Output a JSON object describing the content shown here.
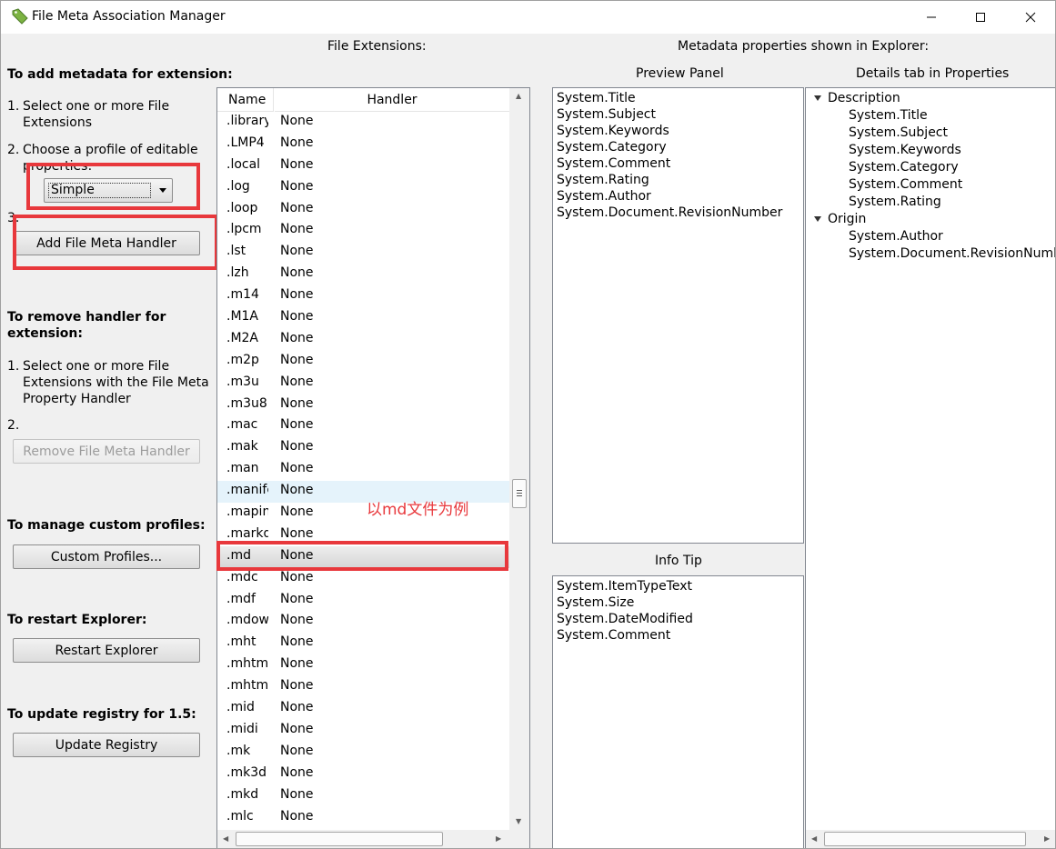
{
  "window": {
    "title": "File Meta Association Manager",
    "controls": {
      "minimize": "—",
      "maximize": "☐",
      "close": "✕"
    }
  },
  "headers": {
    "file_extensions": "File Extensions:",
    "metadata_properties": "Metadata properties shown in Explorer:",
    "preview_panel": "Preview Panel",
    "details_tab": "Details tab in Properties",
    "info_tip": "Info Tip"
  },
  "left": {
    "add_heading": "To add metadata for extension:",
    "add_step1_num": "1.",
    "add_step1_text": "Select one or more File Extensions",
    "add_step2_num": "2.",
    "add_step2_text": "Choose a profile of editable properties:",
    "profile_selected": "Simple",
    "add_step3_num": "3.",
    "add_button": "Add File Meta Handler",
    "remove_heading": "To remove handler for extension:",
    "remove_step1_num": "1.",
    "remove_step1_text": "Select one or more File Extensions with the File Meta Property Handler",
    "remove_step2_num": "2.",
    "remove_button": "Remove File Meta Handler",
    "custom_heading": "To manage custom profiles:",
    "custom_button": "Custom Profiles...",
    "restart_heading": "To restart Explorer:",
    "restart_button": "Restart Explorer",
    "update_heading": "To update registry for 1.5:",
    "update_button": "Update Registry"
  },
  "extension_list": {
    "columns": {
      "name": "Name",
      "handler": "Handler"
    },
    "rows": [
      {
        "name": ".library",
        "handler": "None"
      },
      {
        "name": ".LMP4",
        "handler": "None"
      },
      {
        "name": ".local",
        "handler": "None"
      },
      {
        "name": ".log",
        "handler": "None"
      },
      {
        "name": ".loop",
        "handler": "None"
      },
      {
        "name": ".lpcm",
        "handler": "None"
      },
      {
        "name": ".lst",
        "handler": "None"
      },
      {
        "name": ".lzh",
        "handler": "None"
      },
      {
        "name": ".m14",
        "handler": "None"
      },
      {
        "name": ".M1A",
        "handler": "None"
      },
      {
        "name": ".M2A",
        "handler": "None"
      },
      {
        "name": ".m2p",
        "handler": "None"
      },
      {
        "name": ".m3u",
        "handler": "None"
      },
      {
        "name": ".m3u8",
        "handler": "None"
      },
      {
        "name": ".mac",
        "handler": "None"
      },
      {
        "name": ".mak",
        "handler": "None"
      },
      {
        "name": ".man",
        "handler": "None"
      },
      {
        "name": ".manifest",
        "handler": "None"
      },
      {
        "name": ".mapin",
        "handler": "None"
      },
      {
        "name": ".markd",
        "handler": "None"
      },
      {
        "name": ".md",
        "handler": "None"
      },
      {
        "name": ".mdc",
        "handler": "None"
      },
      {
        "name": ".mdf",
        "handler": "None"
      },
      {
        "name": ".mdow",
        "handler": "None"
      },
      {
        "name": ".mht",
        "handler": "None"
      },
      {
        "name": ".mhtm",
        "handler": "None"
      },
      {
        "name": ".mhtml",
        "handler": "None"
      },
      {
        "name": ".mid",
        "handler": "None"
      },
      {
        "name": ".midi",
        "handler": "None"
      },
      {
        "name": ".mk",
        "handler": "None"
      },
      {
        "name": ".mk3d",
        "handler": "None"
      },
      {
        "name": ".mkd",
        "handler": "None"
      },
      {
        "name": ".mlc",
        "handler": "None"
      }
    ],
    "hover_index": 17,
    "selected_index": 20
  },
  "annotation": "以md文件为例",
  "preview_panel_items": [
    "System.Title",
    "System.Subject",
    "System.Keywords",
    "System.Category",
    "System.Comment",
    "System.Rating",
    "System.Author",
    "System.Document.RevisionNumber"
  ],
  "details_tree": {
    "groups": [
      {
        "label": "Description",
        "items": [
          "System.Title",
          "System.Subject",
          "System.Keywords",
          "System.Category",
          "System.Comment",
          "System.Rating"
        ]
      },
      {
        "label": "Origin",
        "items": [
          "System.Author",
          "System.Document.RevisionNumber"
        ]
      }
    ]
  },
  "info_tip_items": [
    "System.ItemTypeText",
    "System.Size",
    "System.DateModified",
    "System.Comment"
  ],
  "colors": {
    "highlight_red": "#e8383c",
    "hover_row": "#e5f3fb"
  }
}
